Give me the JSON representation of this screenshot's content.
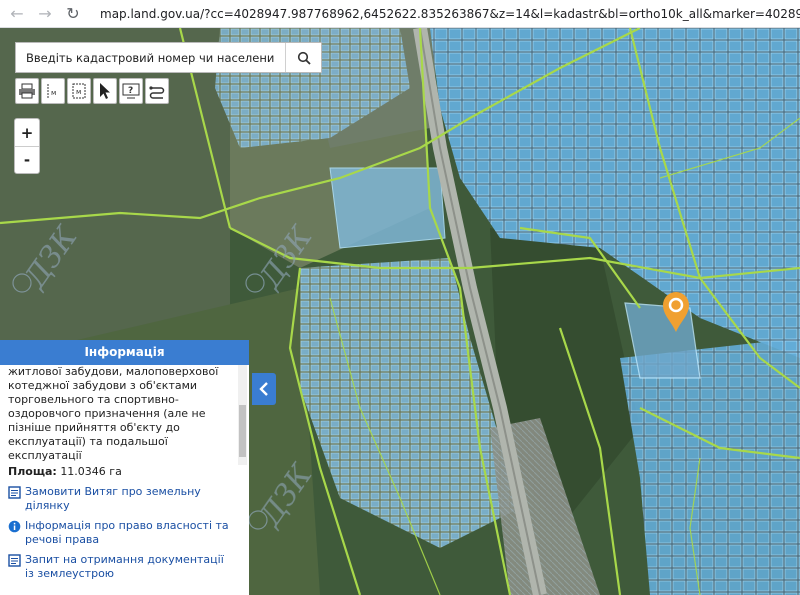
{
  "browser": {
    "url": "map.land.gov.ua/?cc=4028947.987768962,6452622.835263867&z=14&l=kadastr&bl=ortho10k_all&marker=4028947.987768962,64"
  },
  "search": {
    "placeholder": "Введіть кадастровий номер чи населений пункт"
  },
  "tools": [
    "printer-icon",
    "measure-distance-icon",
    "measure-area-icon",
    "select-cursor-icon",
    "help-icon",
    "layers-swap-icon"
  ],
  "zoom": {
    "in_label": "+",
    "out_label": "-"
  },
  "map": {
    "watermark": "ДЗК",
    "colors": {
      "parcel_fill": "#67b8e6",
      "parcel_line": "#9fdcff",
      "boundary": "#a8d84a",
      "marker": "#f0a030"
    }
  },
  "info_panel": {
    "title": "Інформація",
    "description": "житлової забудови, малоповерхової котеджної забудови з об'єктами торговельного та спортивно-оздоровчого призначення (але не пізніше прийняття об'єкту до експлуатації) та подальшої експлуатації",
    "area_label": "Площа:",
    "area_value": "11.0346 га",
    "links": [
      "Замовити Витяг про земельну ділянку",
      "Інформація про право власності та речові права",
      "Запит на отримання документації із землеустрою"
    ]
  }
}
